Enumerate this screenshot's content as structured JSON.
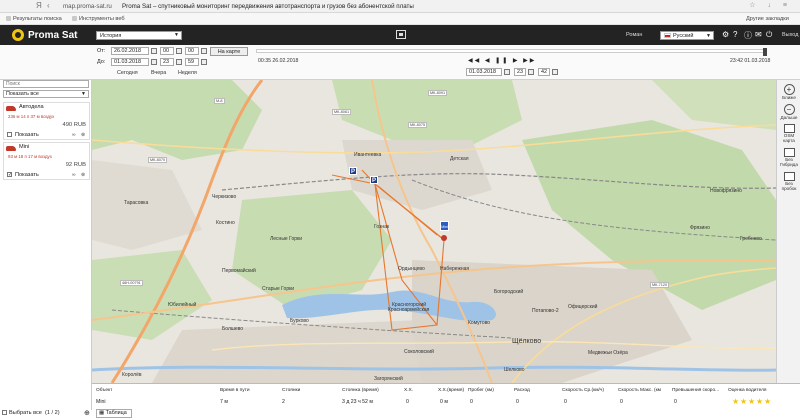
{
  "browser": {
    "logo": "Я",
    "host": "map.proma-sat.ru",
    "title": "Proma Sat – спутниковый мониторинг передвижения автотранспорта и грузов без абонентской платы",
    "bookmarks": [
      "Результаты поиска",
      "Инструменты веб"
    ],
    "other_bookmarks": "Другие закладки"
  },
  "header": {
    "logo": "Proma Sat",
    "mode": "История",
    "user": "Роман",
    "language": "Русский",
    "logout": "Выход"
  },
  "controls": {
    "from_label": "От:",
    "to_label": "До:",
    "from_date": "26.02.2018",
    "to_date": "01.03.2018",
    "from_hour": "00",
    "from_min": "00",
    "to_hour": "23",
    "to_min": "59",
    "to_map_button": "На карте",
    "today": "Сегодня",
    "yesterday": "Вчера",
    "week": "Неделя",
    "start_time": "00:35 26.02.2018",
    "end_time": "23:42 01.03.2018",
    "current_date": "01.03.2018",
    "current_hour": "23",
    "current_min": "42",
    "progress": 1.0
  },
  "sidebar": {
    "search_placeholder": "Поиск",
    "filter": "Показать все",
    "vehicles": [
      {
        "name": "Автодела",
        "desc": "236 м 14 п 37 м воздух",
        "price": "490 RUB",
        "show_label": "Показать",
        "checked": false
      },
      {
        "name": "Mini",
        "desc": "93 м 18 п 17 м воздух",
        "price": "92 RUB",
        "show_label": "Показать",
        "checked": true
      }
    ],
    "select_all": "Выбрать все",
    "count": "(1 / 2)"
  },
  "map": {
    "places": [
      {
        "name": "Ивантеевка"
      },
      {
        "name": "Детская"
      },
      {
        "name": "Тарасовка"
      },
      {
        "name": "Черкизово"
      },
      {
        "name": "Костино"
      },
      {
        "name": "Королёв"
      },
      {
        "name": "Юбилейный"
      },
      {
        "name": "Первомайский"
      },
      {
        "name": "Лесные Горки"
      },
      {
        "name": "Старые Горки"
      },
      {
        "name": "Гознак"
      },
      {
        "name": "Ордынцево"
      },
      {
        "name": "Набережная"
      },
      {
        "name": "Красноармейская"
      },
      {
        "name": "Богородский"
      },
      {
        "name": "Потапово-2"
      },
      {
        "name": "Офицерский"
      },
      {
        "name": "Шелково"
      },
      {
        "name": "Фрязино"
      },
      {
        "name": "Гребнево"
      },
      {
        "name": "Новофрязино"
      },
      {
        "name": "Соколовский"
      },
      {
        "name": "Загорянский"
      },
      {
        "name": "Комутово"
      },
      {
        "name": "Болшево"
      },
      {
        "name": "Бурково"
      },
      {
        "name": "Красногорский"
      },
      {
        "name": "Медвежьи Озёра"
      },
      {
        "name": "Щёлково"
      }
    ],
    "roads": [
      "M-8",
      "МК-8061",
      "МК-8070",
      "МК-8091",
      "МК-7120",
      "МК-8075",
      "46Н-00791"
    ],
    "parking_label": "P",
    "vehicle_marker": "Mini"
  },
  "tools": [
    {
      "icon": "plus-icon",
      "label": "Ближе"
    },
    {
      "icon": "minus-icon",
      "label": "Дальше"
    },
    {
      "icon": "osm-icon",
      "label": "OSM карта"
    },
    {
      "icon": "nolayer-icon",
      "label": "Без Гибрида"
    },
    {
      "icon": "traffic-icon",
      "label": "Без пробок"
    }
  ],
  "table": {
    "headers": [
      "Объект",
      "Время в пути",
      "Стоянки",
      "Стоянка (время)",
      "Х.Х.",
      "Х.Х.(время)",
      "Пробег (км)",
      "Расход",
      "Скорость Ср.(км/ч)",
      "Скорость Макс. (км",
      "Превышения скоро...",
      "Оценка водителя"
    ],
    "row": [
      "Mini",
      "7 м",
      "2",
      "3 д 23 ч 52 м",
      "0",
      "0 м",
      "0",
      "0",
      "0",
      "0",
      "0"
    ],
    "rating": 5,
    "tab": "Таблица"
  }
}
